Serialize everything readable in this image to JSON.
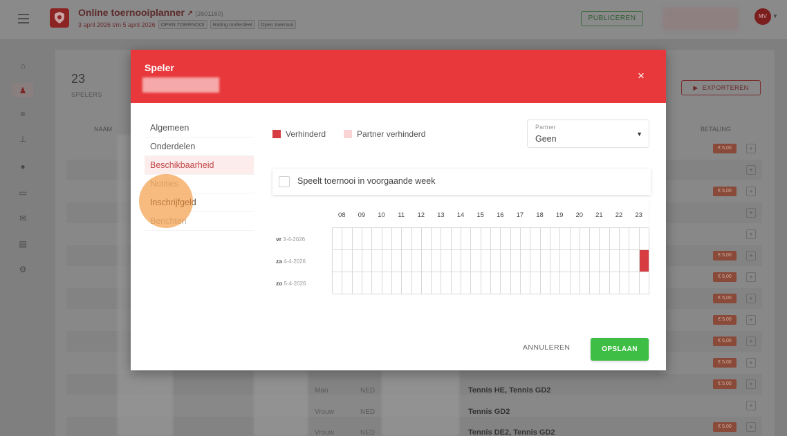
{
  "header": {
    "title": "Online toernooiplanner",
    "title_id": "(2601160)",
    "dates": "3 april 2026 t/m 5 april 2026",
    "tags": [
      "OPEN TOERNOOI",
      "Rating onderdeel",
      "Open toernooi"
    ],
    "publish_label": "PUBLICEREN",
    "avatar_initials": "MV"
  },
  "sidebar": {
    "icons": [
      "home-icon",
      "players-icon",
      "list-icon",
      "tree-icon",
      "ball-icon",
      "monitor-icon",
      "mail-icon",
      "print-icon",
      "settings-icon"
    ],
    "active_index": 1
  },
  "page": {
    "player_count": "23",
    "player_count_label": "SPELERS",
    "export_label": "EXPORTEREN",
    "col_naam": "NAAM",
    "col_betaling": "BETALING",
    "badges": [
      "€ 5,00",
      "",
      "€ 5,00",
      "",
      "",
      "€ 5,00",
      "€ 5,00",
      "€ 5,00",
      "€ 5,00",
      "€ 5,00",
      "€ 5,00",
      "€ 5,00",
      "",
      "€ 5,00"
    ],
    "visible_rows": [
      {
        "gender": "Man",
        "country": "NED",
        "events": "Tennis HE, Tennis GD2"
      },
      {
        "gender": "Vrouw",
        "country": "NED",
        "events": "Tennis GD2"
      },
      {
        "gender": "Vrouw",
        "country": "NED",
        "events": "Tennis DE2, Tennis GD2"
      }
    ]
  },
  "modal": {
    "title": "Speler",
    "close_label": "×",
    "menu": [
      "Algemeen",
      "Onderdelen",
      "Beschikbaarheid",
      "Notities",
      "Inschrijfgeld",
      "Berichten"
    ],
    "active_menu_index": 2,
    "legend": {
      "unavailable": "Verhinderd",
      "partner_unavailable": "Partner verhinderd"
    },
    "colors": {
      "unavailable": "#d63c40",
      "partner_unavailable": "#fad4d5",
      "header": "#e8383b",
      "save": "#3fbe46"
    },
    "partner": {
      "label": "Partner",
      "value": "Geen"
    },
    "prev_week_label": "Speelt toernooi in voorgaande week",
    "prev_week_checked": false,
    "hours": [
      "08",
      "09",
      "10",
      "11",
      "12",
      "13",
      "14",
      "15",
      "16",
      "17",
      "18",
      "19",
      "20",
      "21",
      "22",
      "23"
    ],
    "days": [
      {
        "day": "vr",
        "date": "3-4-2026",
        "unavailable_hours": []
      },
      {
        "day": "za",
        "date": "4-4-2026",
        "unavailable_hours": [
          "23"
        ]
      },
      {
        "day": "zo",
        "date": "5-4-2026",
        "unavailable_hours": []
      }
    ],
    "cancel_label": "ANNULEREN",
    "save_label": "OPSLAAN"
  }
}
